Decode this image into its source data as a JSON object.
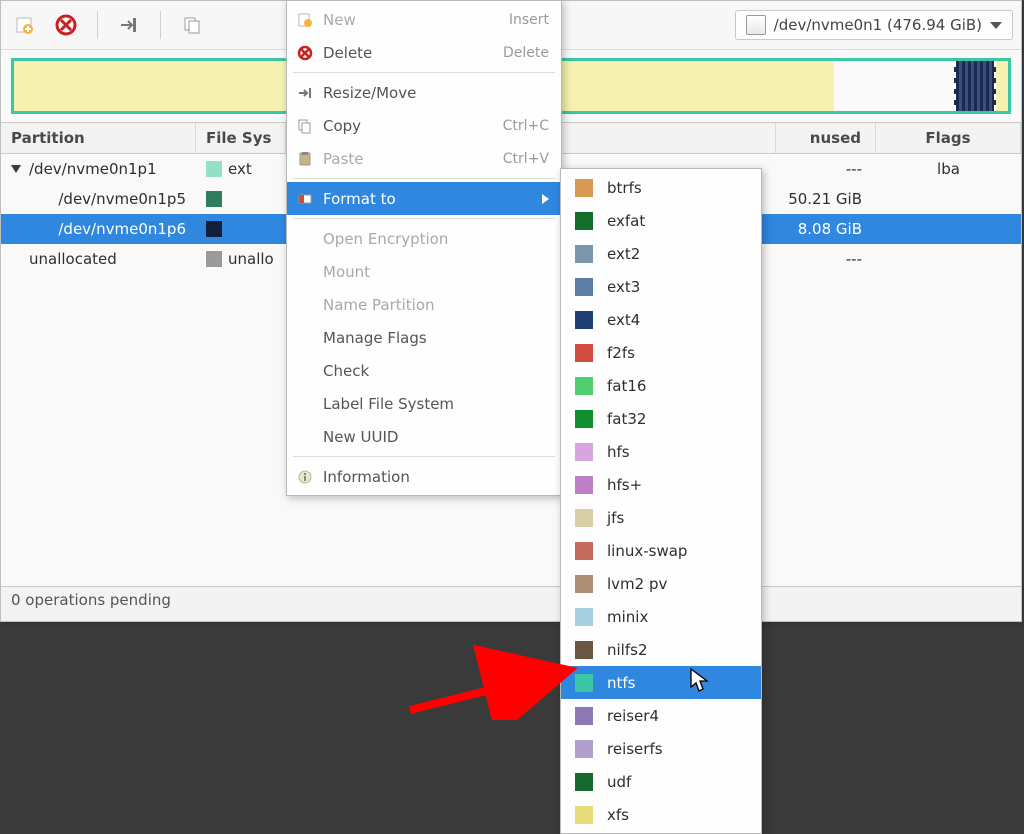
{
  "toolbar": {
    "device_label": "/dev/nvme0n1 (476.94 GiB)"
  },
  "table": {
    "headers": {
      "partition": "Partition",
      "fs": "File Sys",
      "unused": "nused",
      "flags": "Flags"
    },
    "rows": [
      {
        "name": "/dev/nvme0n1p1",
        "indent": 0,
        "expander": true,
        "fs_label": "ext",
        "fs_color": "#94e0c6",
        "unused": "---",
        "flags": "lba",
        "selected": false
      },
      {
        "name": "/dev/nvme0n1p5",
        "indent": 1,
        "expander": false,
        "fs_label": "",
        "fs_color": "#2e7d5c",
        "unused": "50.21 GiB",
        "flags": "",
        "selected": false
      },
      {
        "name": "/dev/nvme0n1p6",
        "indent": 1,
        "expander": false,
        "fs_label": "",
        "fs_color": "#141e3a",
        "unused": "8.08 GiB",
        "flags": "",
        "selected": true
      },
      {
        "name": "unallocated",
        "indent": 0,
        "expander": false,
        "fs_label": "unallo",
        "fs_color": "#9a9a9a",
        "unused": "---",
        "flags": "",
        "selected": false
      }
    ]
  },
  "menu": {
    "items": [
      {
        "label": "New",
        "accel": "Insert",
        "disabled": true,
        "icon": "new"
      },
      {
        "label": "Delete",
        "accel": "Delete",
        "disabled": false,
        "icon": "delete"
      },
      {
        "label": "Resize/Move",
        "accel": "",
        "disabled": false,
        "icon": "resize"
      },
      {
        "label": "Copy",
        "accel": "Ctrl+C",
        "disabled": false,
        "icon": "copy"
      },
      {
        "label": "Paste",
        "accel": "Ctrl+V",
        "disabled": true,
        "icon": "paste"
      },
      {
        "label": "Format to",
        "accel": "",
        "disabled": false,
        "hover": true,
        "submenu": true,
        "icon": "format"
      },
      {
        "label": "Open Encryption",
        "accel": "",
        "disabled": true
      },
      {
        "label": "Mount",
        "accel": "",
        "disabled": true
      },
      {
        "label": "Name Partition",
        "accel": "",
        "disabled": true
      },
      {
        "label": "Manage Flags",
        "accel": "",
        "disabled": false
      },
      {
        "label": "Check",
        "accel": "",
        "disabled": false
      },
      {
        "label": "Label File System",
        "accel": "",
        "disabled": false
      },
      {
        "label": "New UUID",
        "accel": "",
        "disabled": false
      },
      {
        "label": "Information",
        "accel": "",
        "disabled": false,
        "icon": "info"
      }
    ]
  },
  "submenu": {
    "items": [
      {
        "label": "btrfs",
        "color": "#d89a52"
      },
      {
        "label": "exfat",
        "color": "#126e2a"
      },
      {
        "label": "ext2",
        "color": "#7a96ad"
      },
      {
        "label": "ext3",
        "color": "#5d7da2"
      },
      {
        "label": "ext4",
        "color": "#1e3f74"
      },
      {
        "label": "f2fs",
        "color": "#d24b3f"
      },
      {
        "label": "fat16",
        "color": "#4fcf6d"
      },
      {
        "label": "fat32",
        "color": "#108f2f"
      },
      {
        "label": "hfs",
        "color": "#d8a6de"
      },
      {
        "label": "hfs+",
        "color": "#bf7fc4"
      },
      {
        "label": "jfs",
        "color": "#d8cfa6"
      },
      {
        "label": "linux-swap",
        "color": "#c46a5e"
      },
      {
        "label": "lvm2 pv",
        "color": "#ad8f76"
      },
      {
        "label": "minix",
        "color": "#a7cfe0"
      },
      {
        "label": "nilfs2",
        "color": "#6a5643"
      },
      {
        "label": "ntfs",
        "color": "#3ac7a6",
        "hover": true
      },
      {
        "label": "reiser4",
        "color": "#8f79b5"
      },
      {
        "label": "reiserfs",
        "color": "#b0a1cc"
      },
      {
        "label": "udf",
        "color": "#166a2d"
      },
      {
        "label": "xfs",
        "color": "#e7db7a"
      }
    ]
  },
  "status": {
    "text": "0 operations pending"
  }
}
